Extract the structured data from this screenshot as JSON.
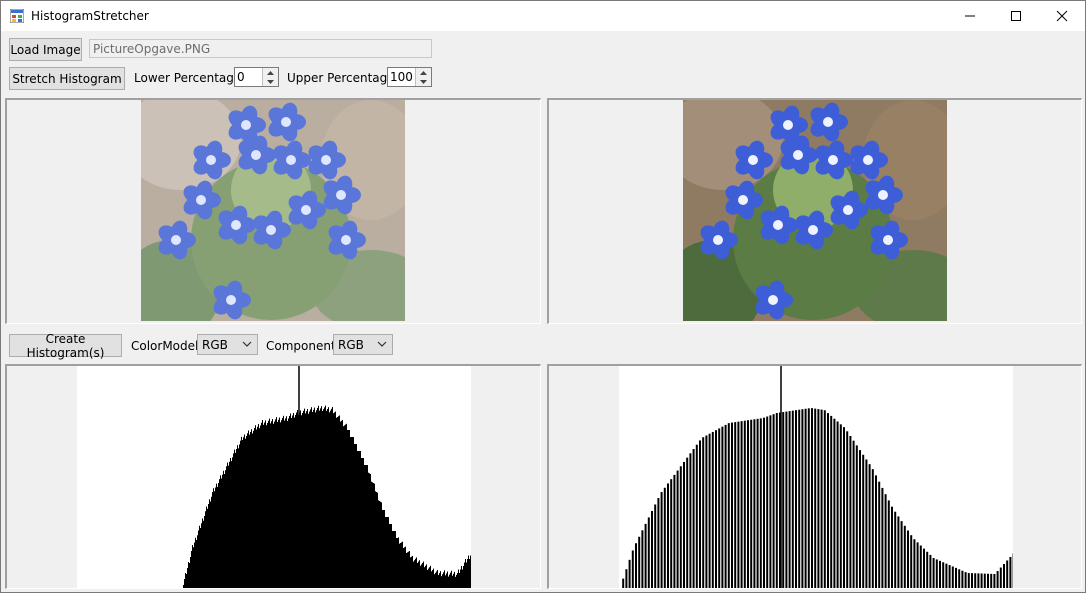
{
  "window": {
    "title": "HistogramStretcher",
    "minimize_icon": "minimize-icon",
    "maximize_icon": "maximize-icon",
    "close_icon": "close-icon"
  },
  "toolbar": {
    "load_image_label": "Load Image",
    "file_path_value": "PictureOpgave.PNG",
    "stretch_label": "Stretch Histogram",
    "lower_label": "Lower Percentage:",
    "lower_value": "0",
    "upper_label": "Upper Percentage:",
    "upper_value": "100"
  },
  "histogram_controls": {
    "create_label": "Create Histogram(s)",
    "color_model_label": "ColorModel:",
    "color_model_value": "RGB",
    "component_label": "Component:",
    "component_value": "RGB"
  },
  "images": {
    "original": "flower-photo-original",
    "stretched": "flower-photo-stretched"
  },
  "colors": {
    "window_bg": "#f0f0f0",
    "histogram_fill": "#000000",
    "flower_blue": "#3d5ed6"
  }
}
